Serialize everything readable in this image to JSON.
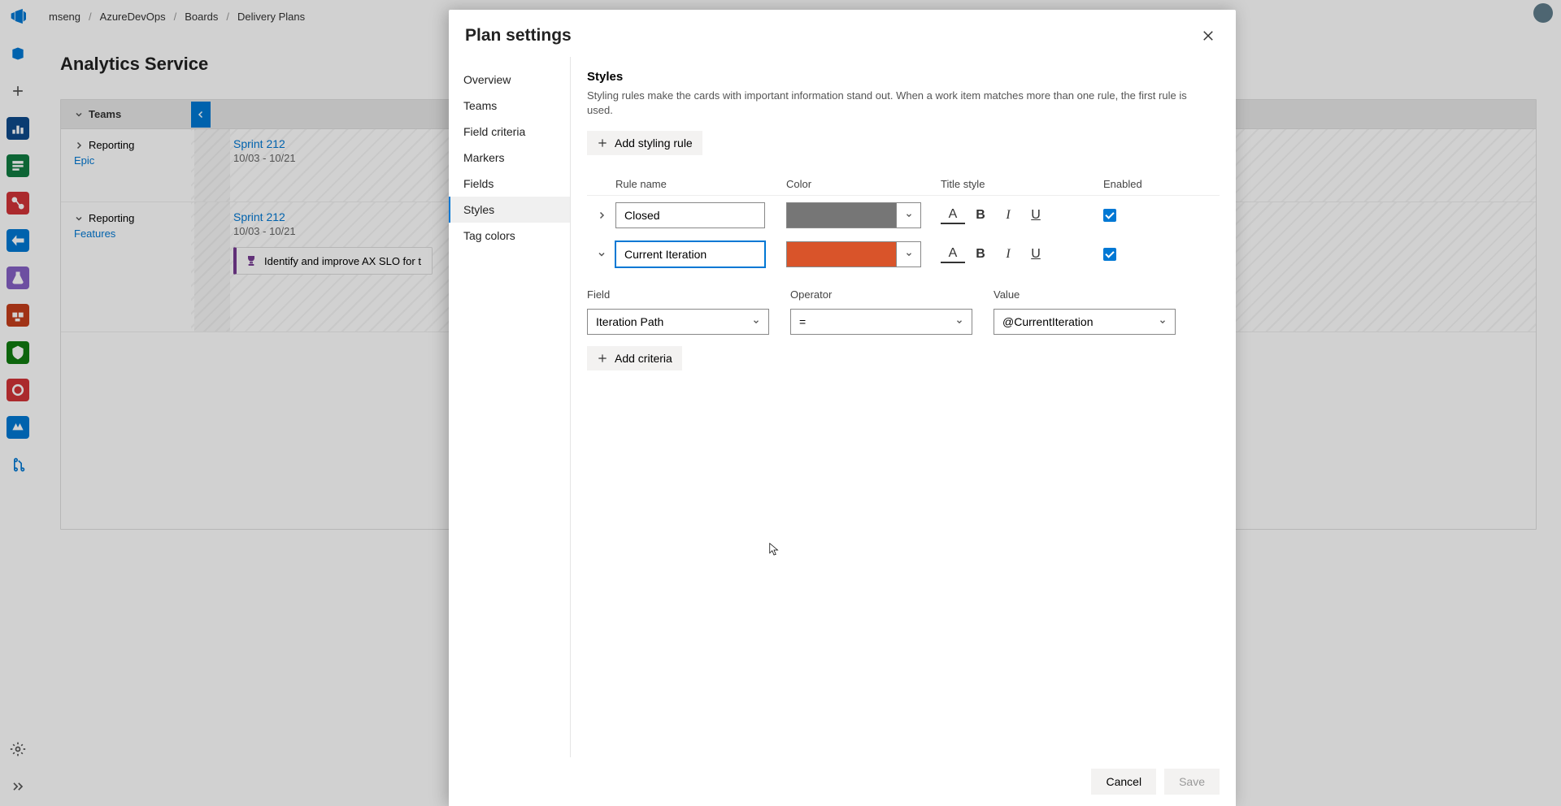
{
  "breadcrumb": {
    "i0": "mseng",
    "i1": "AzureDevOps",
    "i2": "Boards",
    "i3": "Delivery Plans"
  },
  "page": {
    "title": "Analytics Service",
    "teamsHeader": "Teams"
  },
  "teams": {
    "r0": {
      "name": "Reporting",
      "type": "Epic",
      "sprint": "Sprint 212",
      "dates": "10/03 - 10/21"
    },
    "r1": {
      "name": "Reporting",
      "type": "Features",
      "sprint": "Sprint 212",
      "dates": "10/03 - 10/21",
      "card0": "Identify and improve AX SLO for t"
    }
  },
  "panel": {
    "title": "Plan settings",
    "nav": {
      "n0": "Overview",
      "n1": "Teams",
      "n2": "Field criteria",
      "n3": "Markers",
      "n4": "Fields",
      "n5": "Styles",
      "n6": "Tag colors"
    },
    "styles": {
      "title": "Styles",
      "desc": "Styling rules make the cards with important information stand out. When a work item matches more than one rule, the first rule is used.",
      "addRule": "Add styling rule",
      "cols": {
        "name": "Rule name",
        "color": "Color",
        "style": "Title style",
        "enabled": "Enabled"
      },
      "rule0": {
        "name": "Closed",
        "color": "#767676"
      },
      "rule1": {
        "name": "Current Iteration",
        "color": "#d9542a"
      },
      "criteria": {
        "cols": {
          "field": "Field",
          "op": "Operator",
          "val": "Value"
        },
        "row0": {
          "field": "Iteration Path",
          "op": "=",
          "val": "@CurrentIteration"
        },
        "addCriteria": "Add criteria"
      }
    },
    "footer": {
      "cancel": "Cancel",
      "save": "Save"
    }
  }
}
